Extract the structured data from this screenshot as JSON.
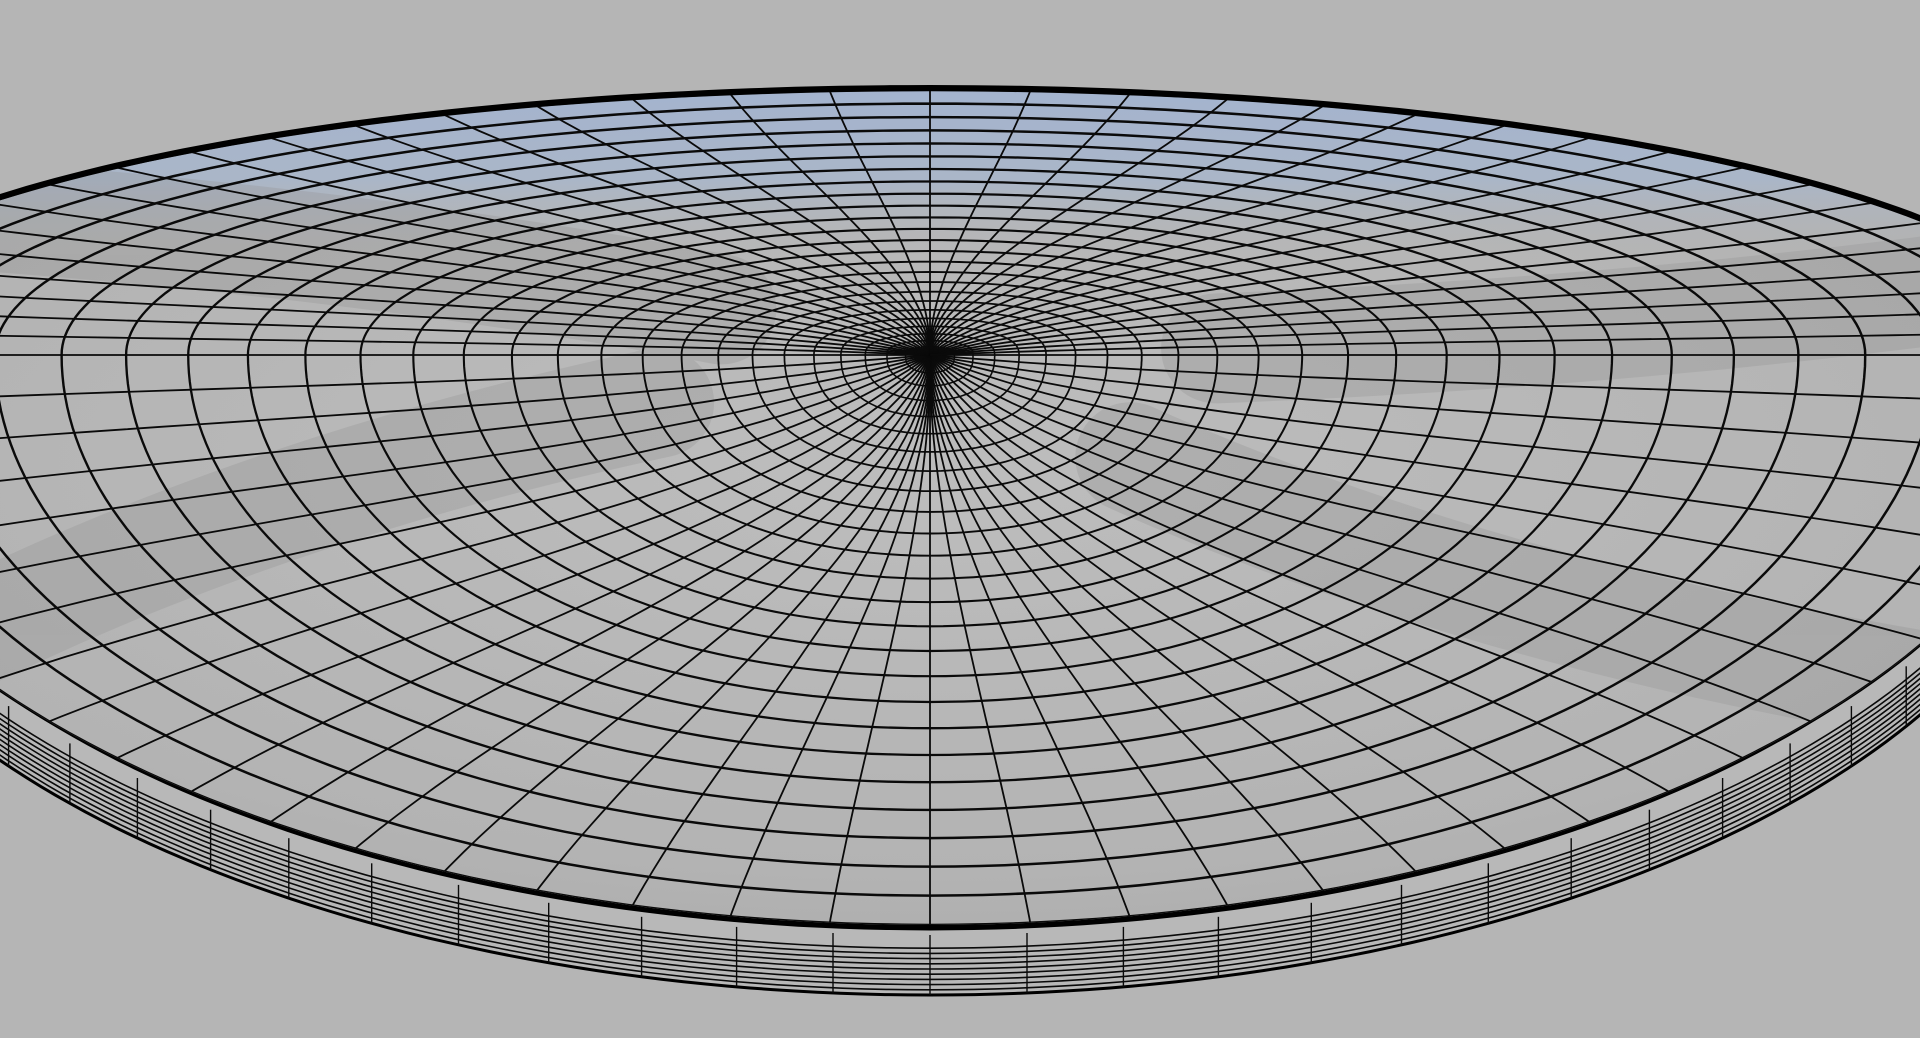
{
  "scene": {
    "subject": "wireframe-shaded-dish",
    "colors": {
      "background": "#b5b5b5",
      "surface_light": "#b8b8b8",
      "surface_mid": "#a9a9a9",
      "shadow": "#8f8f8f",
      "reflection_sky": "#a9b6cc",
      "wire": "#0a0a0a",
      "rim": "#000000"
    },
    "mesh": {
      "rings": 26,
      "spokes": 72,
      "rim_bands": 9,
      "shadow_arms": 4
    }
  }
}
